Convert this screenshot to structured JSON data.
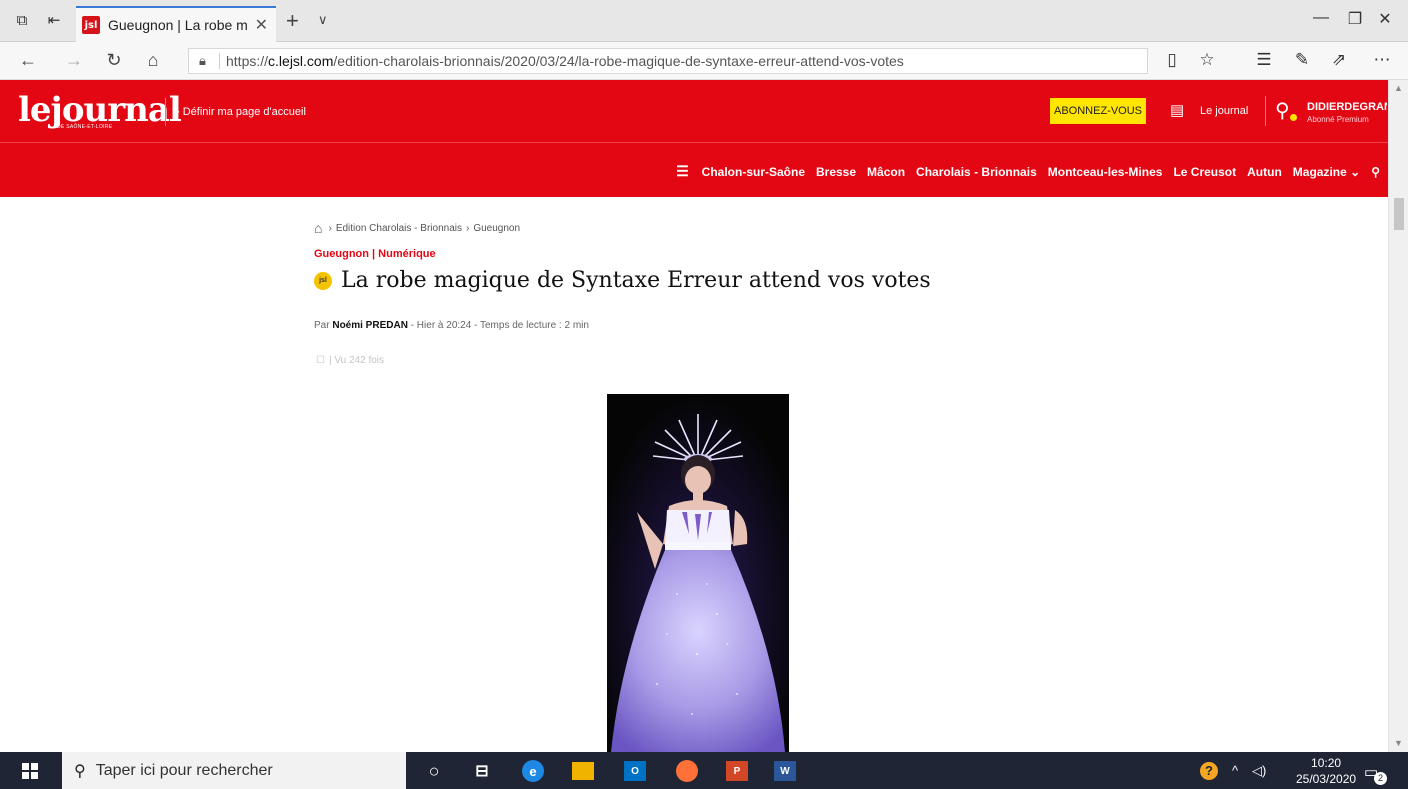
{
  "browser": {
    "tab_favicon_text": "jsl",
    "tab_title": "Gueugnon | La robe ma",
    "url_prefix": "https://",
    "url_domain": "c.lejsl.com",
    "url_path": "/edition-charolais-brionnais/2020/03/24/la-robe-magique-de-syntaxe-erreur-attend-vos-votes"
  },
  "site": {
    "logo_text": "lejournal",
    "logo_sub": "DE SAÔNE-ET-LOIRE",
    "home_link": "›  Définir ma page d'accueil",
    "subscribe": "ABONNEZ-VOUS",
    "journal_link": "Le journal",
    "user_name": "DIDIERDEGRAN...",
    "user_status": "Abonné Premium",
    "nav": [
      "Chalon-sur-Saône",
      "Bresse",
      "Mâcon",
      "Charolais - Brionnais",
      "Montceau-les-Mines",
      "Le Creusot",
      "Autun",
      "Magazine"
    ]
  },
  "article": {
    "breadcrumb": [
      "Edition Charolais - Brionnais",
      "Gueugnon"
    ],
    "kicker": "Gueugnon | Numérique",
    "badge": "jsl",
    "title": "La robe magique de Syntaxe Erreur attend vos votes",
    "by_prefix": "Par",
    "author": "Noémi PREDAN",
    "by_suffix": "- Hier à 20:24 - Temps de lecture : 2 min",
    "views": "| Vu 242 fois"
  },
  "taskbar": {
    "search_placeholder": "Taper ici pour rechercher",
    "time": "10:20",
    "date": "25/03/2020",
    "notifications": "2"
  },
  "colors": {
    "brand_red": "#e30613",
    "subscribe_yellow": "#ffe500",
    "taskbar": "#1f2535"
  }
}
